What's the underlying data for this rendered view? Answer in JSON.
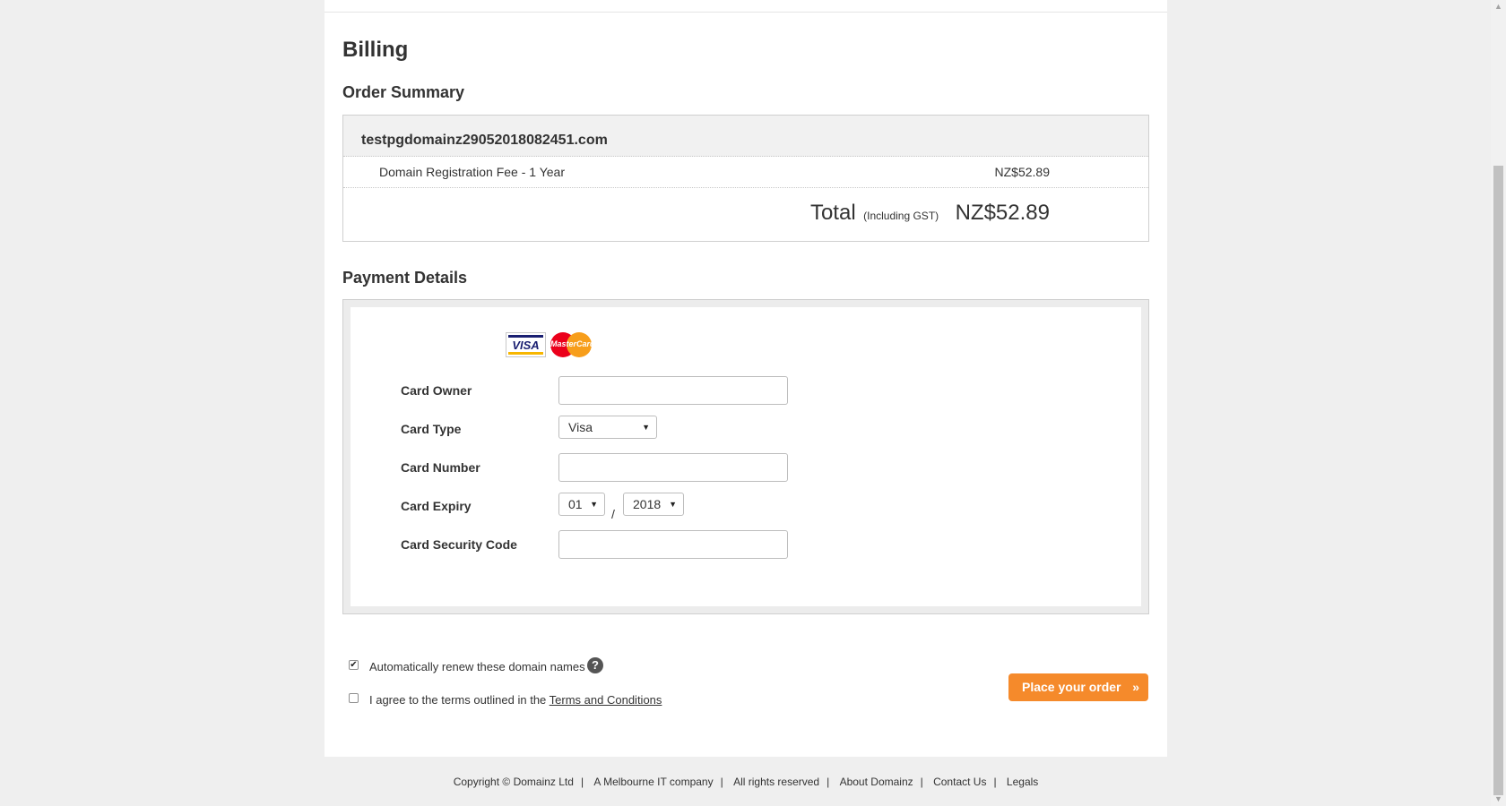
{
  "page": {
    "title": "Billing"
  },
  "order_summary": {
    "title": "Order Summary",
    "domain": "testpgdomainz29052018082451.com",
    "fee_label": "Domain Registration Fee - 1 Year",
    "fee_amount": "NZ$52.89",
    "total_label": "Total",
    "gst_label": "(Including GST)",
    "total_amount": "NZ$52.89"
  },
  "payment": {
    "title": "Payment Details",
    "logos": {
      "visa": "VISA",
      "mastercard": "MasterCard"
    },
    "card_owner_label": "Card Owner",
    "card_owner_value": "",
    "card_type_label": "Card Type",
    "card_type_value": "Visa",
    "card_number_label": "Card Number",
    "card_number_value": "",
    "card_expiry_label": "Card Expiry",
    "expiry_month": "01",
    "expiry_separator": "/",
    "expiry_year": "2018",
    "security_code_label": "Card Security Code",
    "security_code_value": ""
  },
  "options": {
    "auto_renew_label": "Automatically renew these domain names",
    "auto_renew_checked": true,
    "agree_prefix": "I agree to the terms outlined in the ",
    "terms_link": "Terms and Conditions",
    "agree_checked": false
  },
  "actions": {
    "place_order": "Place your order",
    "place_order_icon": "double-chevron-right-icon"
  },
  "footer": {
    "copyright": "Copyright © Domainz Ltd",
    "company": "A Melbourne IT company",
    "rights": "All rights reserved",
    "about": "About Domainz",
    "contact": "Contact Us",
    "legals": "Legals",
    "separator": "|"
  },
  "colors": {
    "accent": "#f58a2b",
    "background": "#efefef"
  }
}
